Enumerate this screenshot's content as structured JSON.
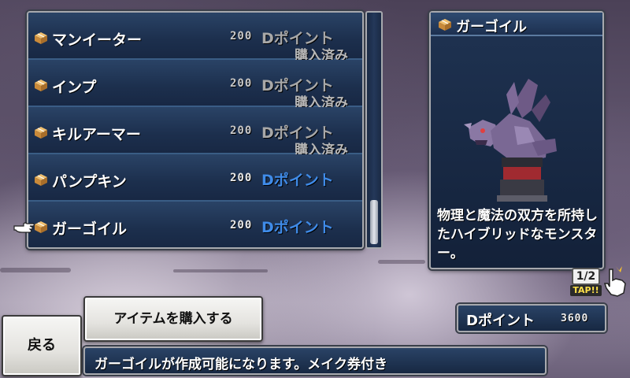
{
  "items": [
    {
      "name": "マンイーター",
      "price": "200",
      "currency": "Dポイント",
      "status": "購入済み",
      "purchased": true
    },
    {
      "name": "インプ",
      "price": "200",
      "currency": "Dポイント",
      "status": "購入済み",
      "purchased": true
    },
    {
      "name": "キルアーマー",
      "price": "200",
      "currency": "Dポイント",
      "status": "購入済み",
      "purchased": true
    },
    {
      "name": "パンプキン",
      "price": "200",
      "currency": "Dポイント",
      "status": "",
      "purchased": false
    },
    {
      "name": "ガーゴイル",
      "price": "200",
      "currency": "Dポイント",
      "status": "",
      "purchased": false
    }
  ],
  "selected_index": 4,
  "scroll_position": 1.0,
  "detail": {
    "title": "ガーゴイル",
    "description": "物理と魔法の双方を所持したハイブリッドなモンスター。",
    "icon": "box-icon",
    "image": "gargoyle-sprite"
  },
  "page": {
    "indicator": "1/2",
    "tap_label": "TAP!!"
  },
  "dpoints": {
    "label": "Dポイント",
    "value": "3600"
  },
  "buttons": {
    "buy": "アイテムを購入する",
    "back": "戻る"
  },
  "message": "ガーゴイルが作成可能になります。メイク券付き",
  "colors": {
    "available_currency": "#3f8be8",
    "purchased_text": "#b8b8b8",
    "panel_bg": "#1f3352"
  }
}
